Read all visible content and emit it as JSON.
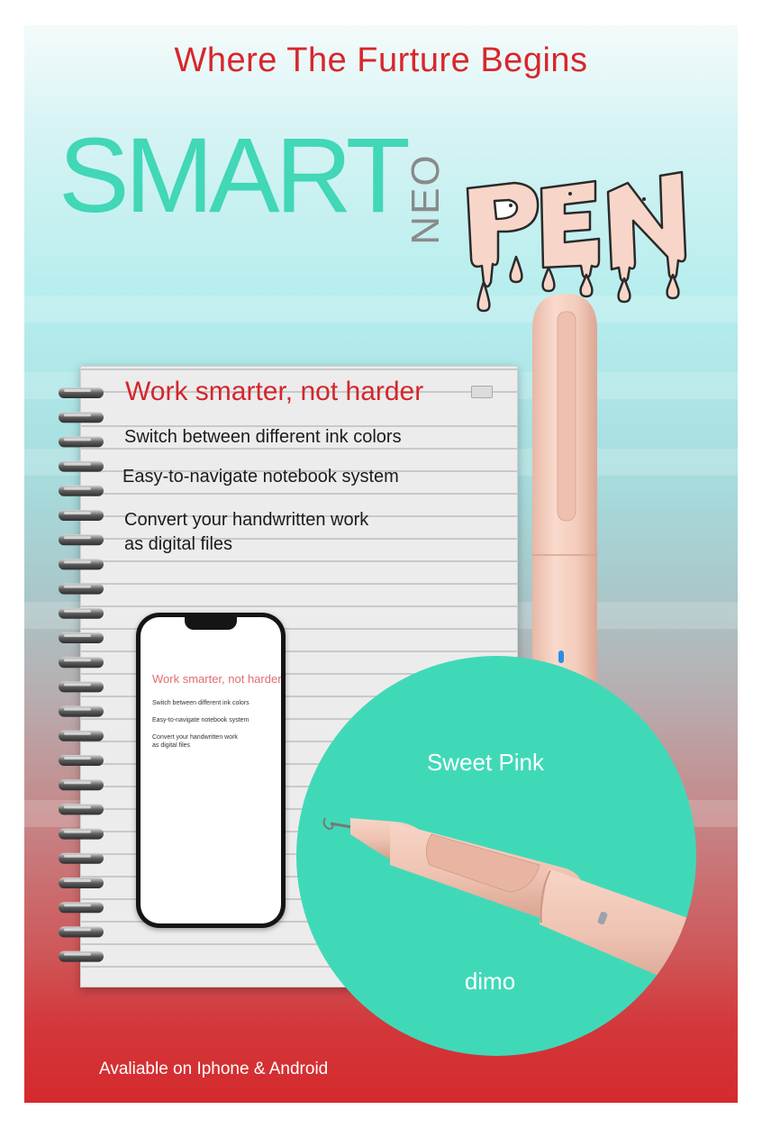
{
  "poster": {
    "tagline": "Where The Furture Begins",
    "brand_word": "SMART",
    "brand_small": "NEO",
    "brand_logo_word": "PEN"
  },
  "notebook": {
    "title": "Work smarter, not harder",
    "features": [
      "Switch between different ink colors",
      "Easy-to-navigate notebook system",
      "Convert your handwritten work",
      "as digital files"
    ]
  },
  "phone": {
    "title": "Work smarter, not harder",
    "features": [
      "Switch between different ink colors",
      "Easy-to-navigate notebook system",
      "Convert your handwritten work",
      "as digital files"
    ]
  },
  "product": {
    "color_name": "Sweet Pink",
    "maker": "dimo"
  },
  "footer": {
    "availability": "Avaliable on Iphone & Android"
  },
  "colors": {
    "accent_red": "#d8262b",
    "brand_teal": "#41d7b7",
    "pen_pink": "#f6cdbd"
  },
  "icons": [
    "pen-icon",
    "spiral-binding-icon",
    "led-indicator-icon"
  ]
}
